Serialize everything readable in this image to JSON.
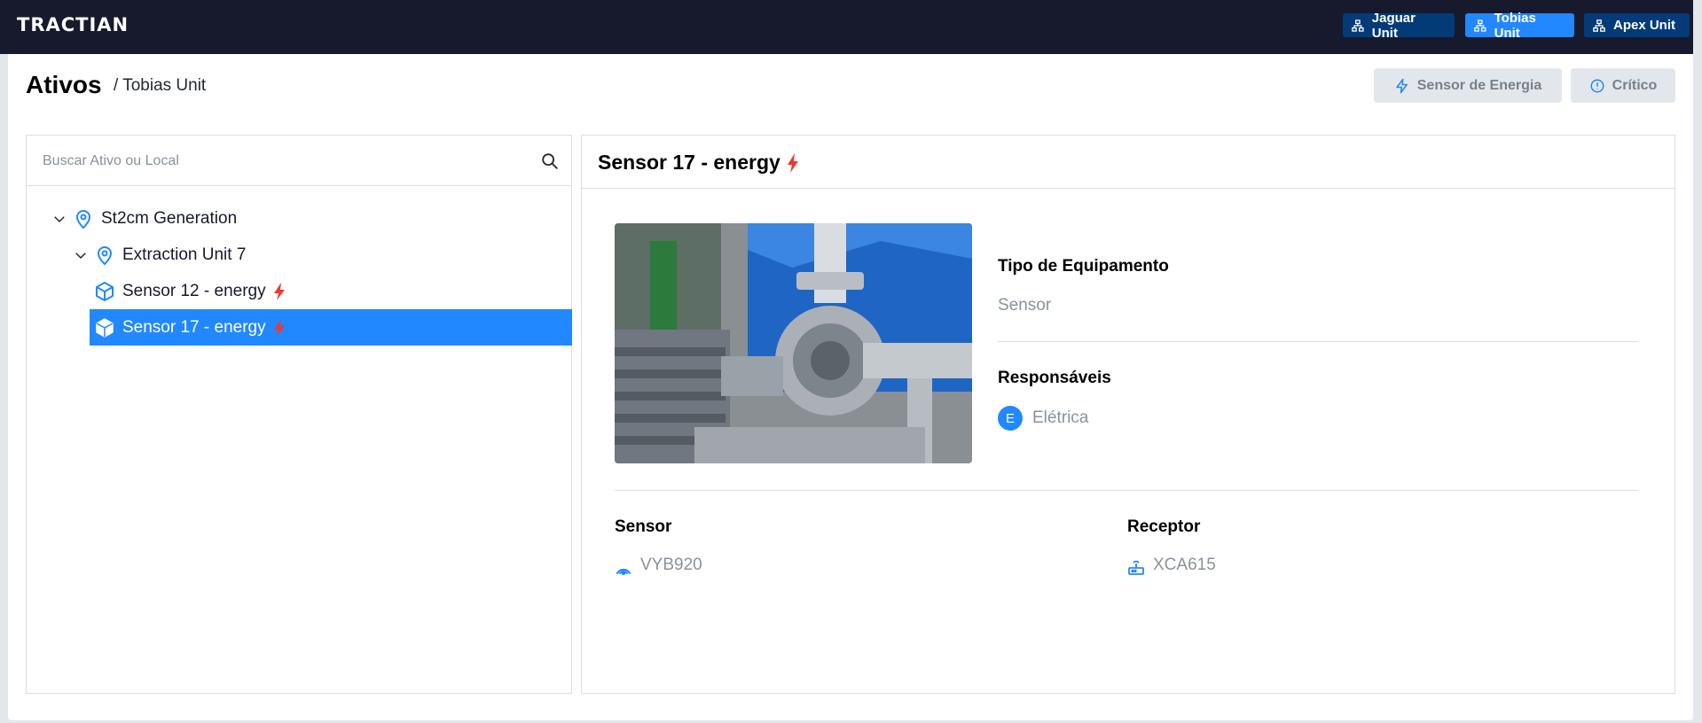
{
  "app": {
    "logo": "TRACTIAN",
    "units": [
      {
        "label": "Jaguar Unit",
        "active": false
      },
      {
        "label": "Tobias Unit",
        "active": true
      },
      {
        "label": "Apex Unit",
        "active": false
      }
    ]
  },
  "header": {
    "title": "Ativos",
    "breadcrumb": "/ Tobias Unit",
    "filters": {
      "energy_label": "Sensor de Energia",
      "critical_label": "Crítico"
    }
  },
  "tree": {
    "search_placeholder": "Buscar Ativo ou Local",
    "items": [
      {
        "label": "St2cm Generation",
        "kind": "location",
        "expanded": true
      },
      {
        "label": "Extraction Unit 7",
        "kind": "location",
        "expanded": true
      },
      {
        "label": "Sensor 12 - energy",
        "kind": "component",
        "sensor": "energy"
      },
      {
        "label": "Sensor 17 - energy",
        "kind": "component",
        "sensor": "energy",
        "selected": true
      }
    ]
  },
  "detail": {
    "title": "Sensor 17 - energy",
    "equipment_type_label": "Tipo de Equipamento",
    "equipment_type_value": "Sensor",
    "responsibles_label": "Responsáveis",
    "responsible_initial": "E",
    "responsible_value": "Elétrica",
    "sensor_label": "Sensor",
    "sensor_value": "VYB920",
    "receptor_label": "Receptor",
    "receptor_value": "XCA615"
  },
  "colors": {
    "topbar": "#17192d",
    "accent": "#2188ff",
    "unit_inactive": "#023b78",
    "energy_bolt": "#ed3833"
  }
}
